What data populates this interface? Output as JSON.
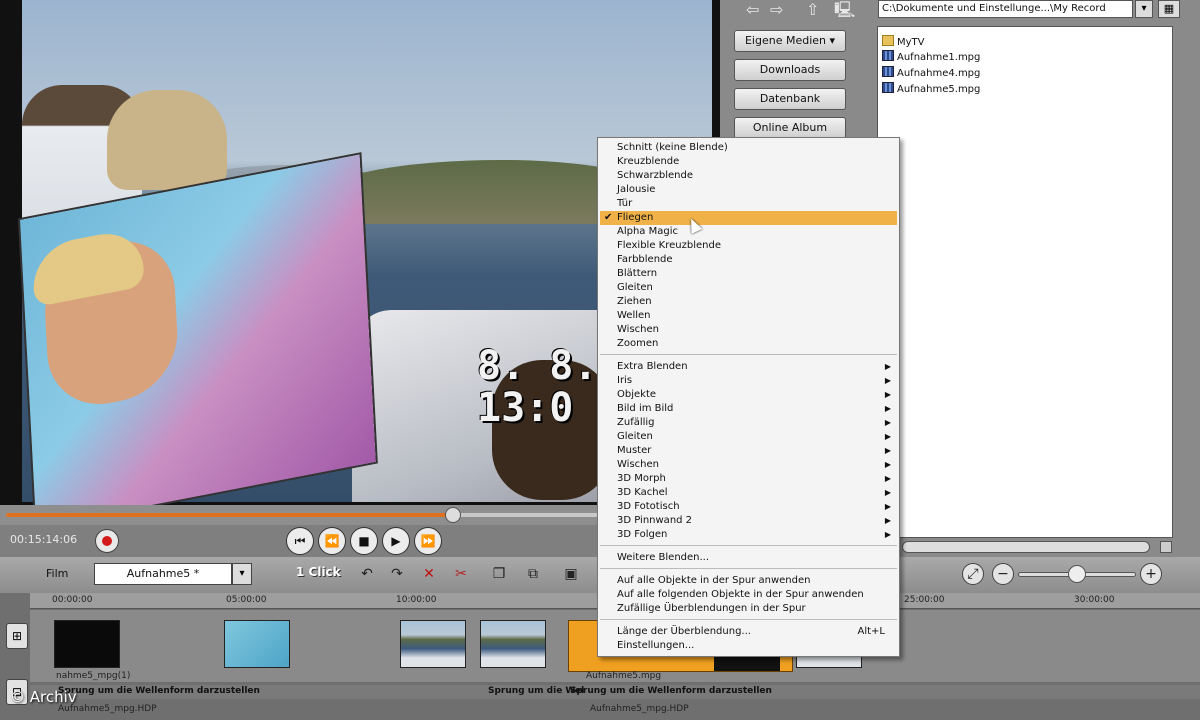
{
  "preview": {
    "osd_line1": "8. 8.9",
    "osd_line2": "13:0",
    "scrub_progress": 0.63,
    "timecode": "00:15:14:06"
  },
  "browser": {
    "path": "C:\\Dokumente und Einstellunge...\\My Record",
    "buttons": [
      "Eigene Medien ▾",
      "Downloads",
      "Datenbank",
      "Online Album"
    ],
    "files": [
      {
        "name": "MyTV",
        "icon": "folder-icon"
      },
      {
        "name": "Aufnahme1.mpg",
        "icon": "video-file-icon"
      },
      {
        "name": "Aufnahme4.mpg",
        "icon": "video-file-icon"
      },
      {
        "name": "Aufnahme5.mpg",
        "icon": "video-file-icon"
      }
    ]
  },
  "toolbar": {
    "film_label": "Film",
    "project_name": "Aufnahme5 *",
    "one_click": "1 Click",
    "zoom_level": 0.5
  },
  "timeline": {
    "ticks": [
      "00:00:00",
      "05:00:00",
      "10:00:00",
      "25:00:00",
      "30:00:00"
    ],
    "clip_label_1": "nahme5_mpg(1)",
    "audio_label_1": "Sprung um die Wellenform darzustellen",
    "audio_label_2": "Sprung um die Wel",
    "audio_label_3": "Sprung um die Wellenform darzustellen",
    "sel_clip_label": "Aufnahme5.mpg",
    "hdp_label_1": "Aufnahme5_mpg.HDP",
    "hdp_label_2": "Aufnahme5_mpg.HDP",
    "watermark": "© Archiv"
  },
  "menu": {
    "group1": [
      "Schnitt (keine Blende)",
      "Kreuzblende",
      "Schwarzblende",
      "Jalousie",
      "Tür",
      "Fliegen",
      "Alpha  Magic",
      "Flexible Kreuzblende",
      "Farbblende",
      "Blättern",
      "Gleiten",
      "Ziehen",
      "Wellen",
      "Wischen",
      "Zoomen"
    ],
    "checked_index": 5,
    "group2": [
      "Extra Blenden",
      "Iris",
      "Objekte",
      "Bild im Bild",
      "Zufällig",
      "Gleiten",
      "Muster",
      "Wischen",
      "3D Morph",
      "3D Kachel",
      "3D Fototisch",
      "3D Pinnwand 2",
      "3D Folgen"
    ],
    "group3": [
      "Weitere Blenden..."
    ],
    "group4": [
      "Auf alle Objekte in der Spur anwenden",
      "Auf alle folgenden Objekte in der Spur anwenden",
      "Zufällige Überblendungen in der Spur"
    ],
    "group5": [
      "Länge der Überblendung...",
      "Einstellungen..."
    ],
    "shortcut_length": "Alt+L"
  },
  "colors": {
    "highlight": "#f0b248",
    "record": "#d21a1a",
    "progress": "#e07020"
  }
}
